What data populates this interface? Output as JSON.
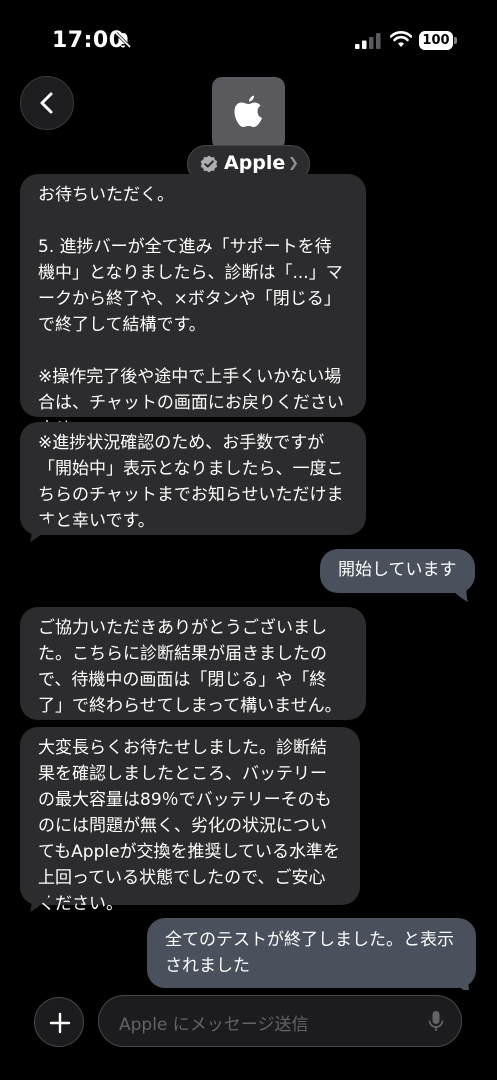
{
  "status": {
    "time": "17:00",
    "battery": "100"
  },
  "header": {
    "contact_name": "Apple"
  },
  "messages": [
    {
      "dir": "in",
      "text": "お待ちいただく。\n\n5. 進捗バーが全て進み「サポートを待機中」となりましたら、診断は「...」マークから終了や、×ボタンや「閉じる」で終了して結構です。\n\n※操作完了後や途中で上手くいかない場合は、チャットの画面にお戻りくださいませ。"
    },
    {
      "dir": "in",
      "text": "※進捗状況確認のため、お手数ですが「開始中」表示となりましたら、一度こちらのチャットまでお知らせいただけますと幸いです。"
    },
    {
      "dir": "out",
      "text": "開始しています"
    },
    {
      "dir": "in",
      "text": "ご協力いただきありがとうございました。こちらに診断結果が届きましたので、待機中の画面は「閉じる」や「終了」で終わらせてしまって構いません。"
    },
    {
      "dir": "in",
      "text": "大変長らくお待たせしました。診断結果を確認しましたところ、バッテリーの最大容量は89％でバッテリーそのものには問題が無く、劣化の状況についてもAppleが交換を推奨している水準を上回っている状態でしたので、ご安心ください。"
    },
    {
      "dir": "out",
      "text": "全てのテストが終了しました。と表示されました"
    }
  ],
  "composer": {
    "placeholder": "Apple にメッセージ送信"
  }
}
